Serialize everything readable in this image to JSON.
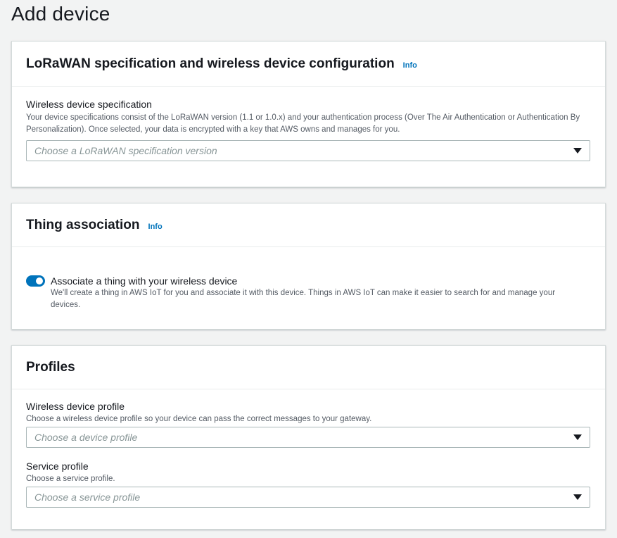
{
  "page": {
    "title": "Add device"
  },
  "lorawan": {
    "title": "LoRaWAN specification and wireless device configuration",
    "info": "Info",
    "spec_label": "Wireless device specification",
    "spec_desc": "Your device specifications consist of the LoRaWAN version (1.1 or 1.0.x) and your authentication process (Over The Air Authentication or Authentication By Personalization). Once selected, your data is encrypted with a key that AWS owns and manages for you.",
    "spec_placeholder": "Choose a LoRaWAN specification version"
  },
  "thing": {
    "title": "Thing association",
    "info": "Info",
    "toggle_on": true,
    "toggle_label": "Associate a thing with your wireless device",
    "toggle_desc": "We'll create a thing in AWS IoT for you and associate it with this device. Things in AWS IoT can make it easier to search for and manage your devices."
  },
  "profiles": {
    "title": "Profiles",
    "device_profile_label": "Wireless device profile",
    "device_profile_desc": "Choose a wireless device profile so your device can pass the correct messages to your gateway.",
    "device_profile_placeholder": "Choose a device profile",
    "service_profile_label": "Service profile",
    "service_profile_desc": "Choose a service profile.",
    "service_profile_placeholder": "Choose a service profile"
  },
  "colors": {
    "accent": "#0073bb",
    "background": "#f2f3f3",
    "panel": "#ffffff",
    "placeholder": "#879596"
  }
}
